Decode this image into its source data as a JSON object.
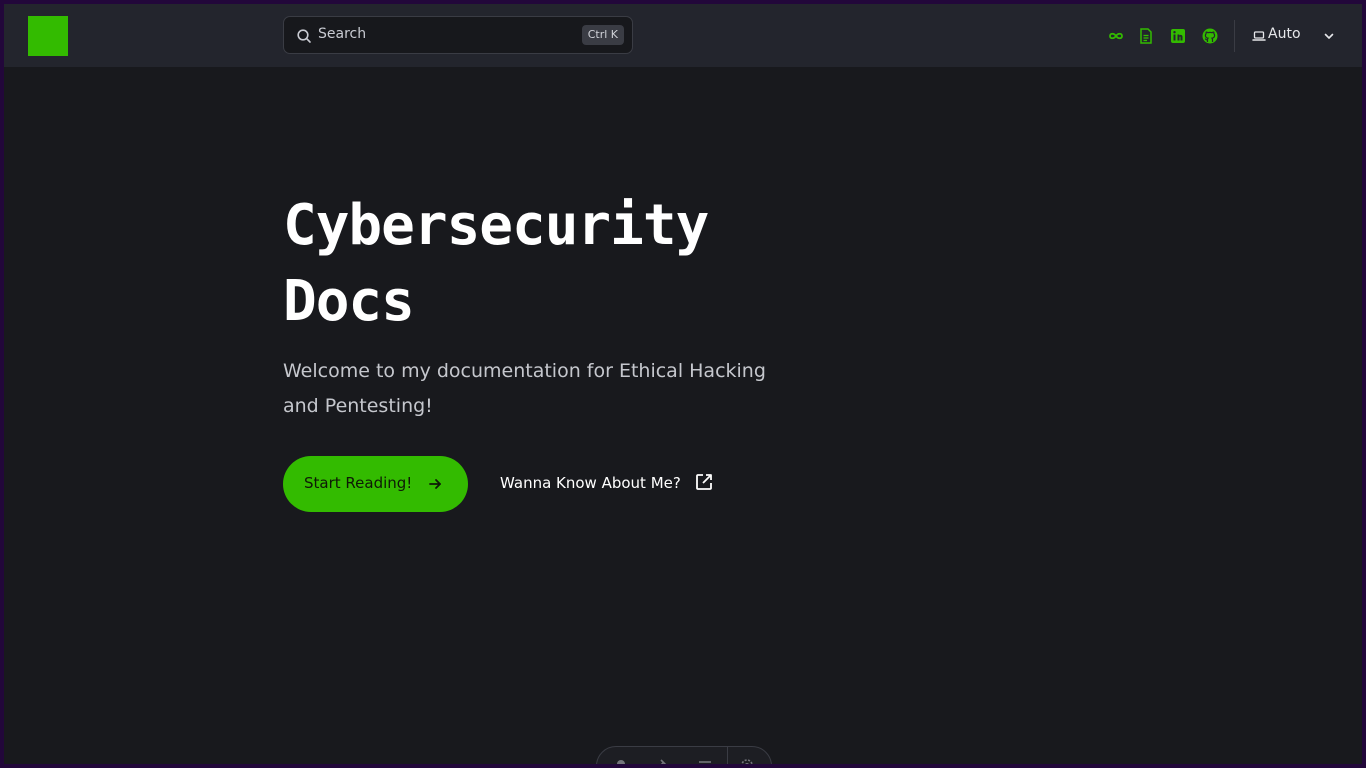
{
  "colors": {
    "accent": "#33bb00",
    "background": "#18191d",
    "navbar": "#23252d",
    "outer_border": "#22073a"
  },
  "navbar": {
    "logo": "logo-square",
    "search": {
      "placeholder": "Search",
      "shortcut": "Ctrl K"
    },
    "icons": [
      "infinity-icon",
      "file-text-icon",
      "linkedin-icon",
      "github-icon"
    ],
    "theme": {
      "icon": "laptop-icon",
      "label": "Auto"
    }
  },
  "hero": {
    "title_line1": "Cybersecurity",
    "title_line2": "Docs",
    "subtitle_line1": "Welcome to my documentation for Ethical Hacking",
    "subtitle_line2": "and Pentesting!",
    "primary_cta": "Start Reading!",
    "secondary_cta": "Wanna Know About Me?"
  },
  "bottom_toolbar": {
    "icons": [
      "bell-icon",
      "tools-icon",
      "menu-icon",
      "settings-icon"
    ]
  }
}
